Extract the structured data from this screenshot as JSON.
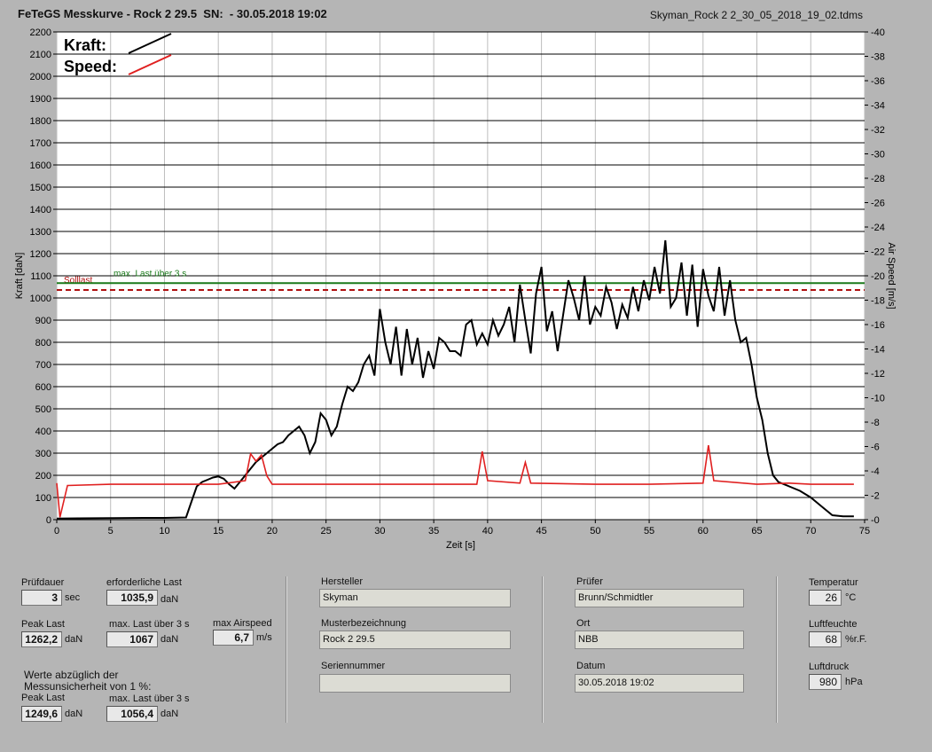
{
  "header": {
    "title": "FeTeGS Messkurve - Rock 2 29.5  SN:  - 30.05.2018 19:02",
    "filename": "Skyman_Rock 2 2_30_05_2018_19_02.tdms"
  },
  "chart_data": {
    "type": "line",
    "xlabel": "Zeit [s]",
    "ylabel": "Kraft [daN]",
    "y2label": "Air Speed [m/s]",
    "xlim": [
      0,
      75
    ],
    "ylim": [
      0,
      2200
    ],
    "y2lim": [
      0,
      40
    ],
    "x_ticks": [
      "0",
      "5",
      "10",
      "15",
      "20",
      "25",
      "30",
      "35",
      "40",
      "45",
      "50",
      "55",
      "60",
      "65",
      "70",
      "75"
    ],
    "y_ticks": [
      "0",
      "100",
      "200",
      "300",
      "400",
      "500",
      "600",
      "700",
      "800",
      "900",
      "1000",
      "1100",
      "1200",
      "1300",
      "1400",
      "1500",
      "1600",
      "1700",
      "1800",
      "1900",
      "2000",
      "2100",
      "2200"
    ],
    "y2_ticks": [
      "0",
      "2",
      "4",
      "6",
      "8",
      "10",
      "12",
      "14",
      "16",
      "18",
      "20",
      "22",
      "24",
      "26",
      "28",
      "30",
      "32",
      "34",
      "36",
      "38",
      "40"
    ],
    "legend": [
      {
        "label": "Kraft:",
        "color": "#000000"
      },
      {
        "label": "Speed:",
        "color": "#e02020"
      }
    ],
    "reference_lines": [
      {
        "label": "Solllast",
        "y": 1036,
        "color": "#b01010",
        "style": "dashed"
      },
      {
        "label": "max. Last über  3 s",
        "y": 1067,
        "color": "#1a7a1a",
        "style": "solid"
      }
    ],
    "series": [
      {
        "name": "Kraft",
        "axis": "left",
        "color": "#000000",
        "x": [
          0,
          2,
          5,
          8,
          10,
          12,
          12.5,
          13,
          13.5,
          14,
          14.5,
          15,
          15.5,
          16,
          16.5,
          17,
          17.5,
          18,
          18.5,
          19,
          19.5,
          20,
          20.5,
          21,
          21.5,
          22,
          22.5,
          23,
          23.5,
          24,
          24.5,
          25,
          25.5,
          26,
          26.5,
          27,
          27.5,
          28,
          28.5,
          29,
          29.5,
          30,
          30.5,
          31,
          31.5,
          32,
          32.5,
          33,
          33.5,
          34,
          34.5,
          35,
          35.5,
          36,
          36.5,
          37,
          37.5,
          38,
          38.5,
          39,
          39.5,
          40,
          40.5,
          41,
          41.5,
          42,
          42.5,
          43,
          43.5,
          44,
          44.5,
          45,
          45.5,
          46,
          46.5,
          47,
          47.5,
          48,
          48.5,
          49,
          49.5,
          50,
          50.5,
          51,
          51.5,
          52,
          52.5,
          53,
          53.5,
          54,
          54.5,
          55,
          55.5,
          56,
          56.5,
          57,
          57.5,
          58,
          58.5,
          59,
          59.5,
          60,
          60.5,
          61,
          61.5,
          62,
          62.5,
          63,
          63.5,
          64,
          64.5,
          65,
          65.5,
          66,
          66.5,
          67,
          68,
          69,
          70,
          71,
          72,
          73,
          74
        ],
        "values": [
          5,
          6,
          7,
          8,
          8,
          10,
          80,
          150,
          170,
          180,
          190,
          195,
          185,
          160,
          140,
          170,
          200,
          230,
          260,
          280,
          300,
          320,
          340,
          350,
          380,
          400,
          420,
          380,
          300,
          350,
          480,
          450,
          380,
          420,
          520,
          600,
          580,
          620,
          700,
          740,
          650,
          950,
          800,
          700,
          870,
          650,
          860,
          700,
          820,
          640,
          760,
          680,
          820,
          800,
          760,
          760,
          740,
          880,
          900,
          790,
          840,
          790,
          900,
          830,
          880,
          960,
          800,
          1060,
          900,
          750,
          1020,
          1140,
          850,
          940,
          760,
          920,
          1080,
          1000,
          900,
          1100,
          880,
          960,
          920,
          1050,
          980,
          860,
          970,
          910,
          1050,
          940,
          1080,
          990,
          1140,
          1020,
          1260,
          960,
          1000,
          1160,
          920,
          1150,
          870,
          1130,
          1010,
          940,
          1140,
          920,
          1080,
          900,
          800,
          820,
          700,
          550,
          450,
          300,
          200,
          170,
          150,
          130,
          100,
          60,
          20,
          15,
          15
        ]
      },
      {
        "name": "Speed",
        "axis": "right",
        "color": "#e02020",
        "x": [
          0,
          0.3,
          1,
          5,
          10,
          15,
          17.5,
          18,
          18.5,
          19,
          19.5,
          20,
          22,
          25,
          30,
          35,
          39,
          39.5,
          40,
          43,
          43.5,
          44,
          50,
          55,
          60,
          60.5,
          61,
          65,
          68,
          70,
          72,
          74
        ],
        "values": [
          3.0,
          0.2,
          2.8,
          2.9,
          2.9,
          2.9,
          3.2,
          5.4,
          4.8,
          5.3,
          3.6,
          2.9,
          2.9,
          2.9,
          2.9,
          2.9,
          2.9,
          5.6,
          3.2,
          3.0,
          4.7,
          3.0,
          2.9,
          2.9,
          3.0,
          6.1,
          3.2,
          2.9,
          3.0,
          2.9,
          2.9,
          2.9
        ]
      }
    ]
  },
  "panel": {
    "pruefdauer": {
      "label": "Prüfdauer",
      "value": "3",
      "unit": "sec"
    },
    "erforderliche_last": {
      "label": "erforderliche Last",
      "value": "1035,9",
      "unit": "daN"
    },
    "peak_last": {
      "label": "Peak Last",
      "value": "1262,2",
      "unit": "daN"
    },
    "max_last": {
      "label": "max. Last über  3 s",
      "value": "1067",
      "unit": "daN"
    },
    "max_airspeed": {
      "label": "max Airspeed",
      "value": "6,7",
      "unit": "m/s"
    },
    "werte_note_1": "Werte abzüglich der",
    "werte_note_2": "Messunsicherheit von 1  %:",
    "peak_last_corr": {
      "label": "Peak Last",
      "value": "1249,6",
      "unit": "daN"
    },
    "max_last_corr": {
      "label": "max. Last über  3 s",
      "value": "1056,4",
      "unit": "daN"
    },
    "hersteller": {
      "label": "Hersteller",
      "value": "Skyman"
    },
    "musterbezeichnung": {
      "label": "Musterbezeichnung",
      "value": "Rock 2 29.5"
    },
    "seriennummer": {
      "label": "Seriennummer",
      "value": ""
    },
    "pruefer": {
      "label": "Prüfer",
      "value": "Brunn/Schmidtler"
    },
    "ort": {
      "label": "Ort",
      "value": "NBB"
    },
    "datum": {
      "label": "Datum",
      "value": "30.05.2018 19:02"
    },
    "temperatur": {
      "label": "Temperatur",
      "value": "26",
      "unit": "°C"
    },
    "luftfeuchte": {
      "label": "Luftfeuchte",
      "value": "68",
      "unit": "%r.F."
    },
    "luftdruck": {
      "label": "Luftdruck",
      "value": "980",
      "unit": "hPa"
    }
  }
}
